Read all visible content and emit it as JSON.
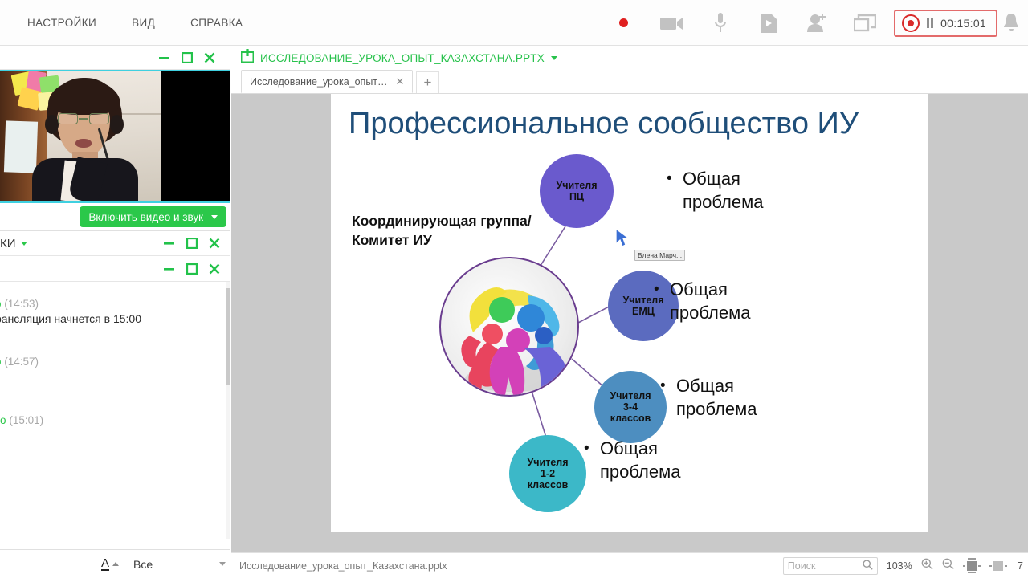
{
  "topbar": {
    "menu": [
      {
        "label": "НАСТРОЙКИ",
        "name": "menu-settings"
      },
      {
        "label": "ВИД",
        "name": "menu-view"
      },
      {
        "label": "СПРАВКА",
        "name": "menu-help"
      }
    ],
    "tools": [
      {
        "name": "record-dot-icon"
      },
      {
        "name": "camera-icon"
      },
      {
        "name": "microphone-icon"
      },
      {
        "name": "play-file-icon"
      },
      {
        "name": "add-user-icon"
      },
      {
        "name": "share-screen-icon"
      }
    ],
    "recorder": {
      "time": "00:15:01",
      "color": "#d92a2a"
    },
    "bell": "notification-bell-icon"
  },
  "left_panel": {
    "video": {
      "button_label": "Включить видео и звук",
      "button_color": "#2bc84a"
    },
    "chat_panel_title": "КИ",
    "messages": [
      {
        "name": "о",
        "time": "(14:53)",
        "text": "рансляция начнется в 15:00"
      },
      {
        "name": "о",
        "time": "(14:57)",
        "text": ""
      },
      {
        "name": "ко",
        "time": "(15:01)",
        "text": ""
      }
    ],
    "footer": {
      "font_icon": "A",
      "filter_label": "Все"
    }
  },
  "document": {
    "title": "ИССЛЕДОВАНИЕ_УРОКА_ОПЫТ_КАЗАХСТАНА.PPTX",
    "tab_label": "Исследование_урока_опыт…",
    "tab_close": "✕",
    "new_tab": "+",
    "slide": {
      "title": "Профессиональное сообщество ИУ",
      "center_label": "Координирующая группа/\nКомитет ИУ",
      "center_image": "teamwork-figures-image",
      "nodes": [
        {
          "label": "Учителя\nПЦ",
          "color": "#6a5acd",
          "bullet": "Общая\nпроблема"
        },
        {
          "label": "Учителя\nЕМЦ",
          "color": "#5b6bbf",
          "bullet": "Общая\nпроблема"
        },
        {
          "label": "Учителя\n3-4\nклассов",
          "color": "#4d8ec0",
          "bullet": "Общая\nпроблема"
        },
        {
          "label": "Учителя\n1-2\nклассов",
          "color": "#3cb8c8",
          "bullet": "Общая\nпроблема"
        }
      ],
      "cursor_tag": "Влена Марч...",
      "title_color": "#1f4e79"
    },
    "statusbar": {
      "filename": "Исследование_урока_опыт_Казахстана.pptx",
      "search_placeholder": "Поиск",
      "zoom": "103%",
      "page": "7"
    }
  }
}
